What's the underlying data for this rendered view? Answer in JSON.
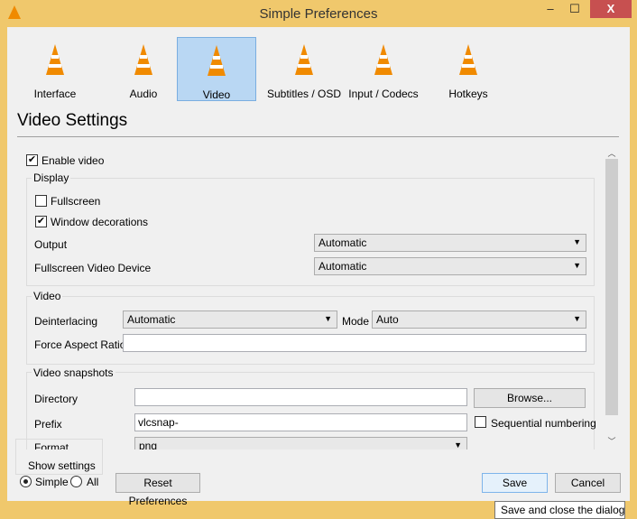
{
  "window": {
    "title": "Simple Preferences",
    "minimize": "–",
    "maximize": "☐",
    "close": "X"
  },
  "categories": [
    {
      "label": "Interface",
      "icon": "interface-cone-icon",
      "selected": false
    },
    {
      "label": "Audio",
      "icon": "audio-headphones-cone-icon",
      "selected": false
    },
    {
      "label": "Video",
      "icon": "video-glasses-cone-icon",
      "selected": true
    },
    {
      "label": "Subtitles / OSD",
      "icon": "subtitles-display-cone-icon",
      "selected": false
    },
    {
      "label": "Input / Codecs",
      "icon": "input-cables-cone-icon",
      "selected": false
    },
    {
      "label": "Hotkeys",
      "icon": "hotkeys-keys-cone-icon",
      "selected": false
    }
  ],
  "heading": "Video Settings",
  "enable_video": {
    "label": "Enable video",
    "checked": true
  },
  "display": {
    "title": "Display",
    "fullscreen": {
      "label": "Fullscreen",
      "checked": false
    },
    "window_decorations": {
      "label": "Window decorations",
      "checked": true
    },
    "output_label": "Output",
    "output_value": "Automatic",
    "fs_device_label": "Fullscreen Video Device",
    "fs_device_value": "Automatic"
  },
  "video": {
    "title": "Video",
    "deinterlacing_label": "Deinterlacing",
    "deinterlacing_value": "Automatic",
    "mode_label": "Mode",
    "mode_value": "Auto",
    "aspect_label": "Force Aspect Ratio",
    "aspect_value": ""
  },
  "snapshots": {
    "title": "Video snapshots",
    "directory_label": "Directory",
    "directory_value": "",
    "browse": "Browse...",
    "prefix_label": "Prefix",
    "prefix_value": "vlcsnap-",
    "sequential": {
      "label": "Sequential numbering",
      "checked": false
    },
    "format_label": "Format",
    "format_value": "png"
  },
  "show_settings": {
    "title": "Show settings",
    "simple": "Simple",
    "all": "All",
    "selected": "Simple"
  },
  "buttons": {
    "reset": "Reset Preferences",
    "save": "Save",
    "cancel": "Cancel"
  },
  "tooltip": "Save and close the dialog"
}
